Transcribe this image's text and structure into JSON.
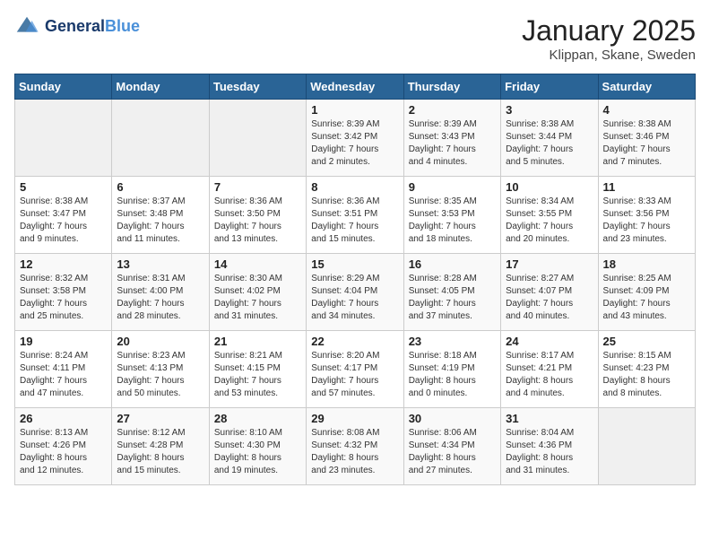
{
  "header": {
    "logo_line1": "General",
    "logo_line2": "Blue",
    "title": "January 2025",
    "subtitle": "Klippan, Skane, Sweden"
  },
  "weekdays": [
    "Sunday",
    "Monday",
    "Tuesday",
    "Wednesday",
    "Thursday",
    "Friday",
    "Saturday"
  ],
  "weeks": [
    [
      {
        "day": "",
        "info": ""
      },
      {
        "day": "",
        "info": ""
      },
      {
        "day": "",
        "info": ""
      },
      {
        "day": "1",
        "info": "Sunrise: 8:39 AM\nSunset: 3:42 PM\nDaylight: 7 hours\nand 2 minutes."
      },
      {
        "day": "2",
        "info": "Sunrise: 8:39 AM\nSunset: 3:43 PM\nDaylight: 7 hours\nand 4 minutes."
      },
      {
        "day": "3",
        "info": "Sunrise: 8:38 AM\nSunset: 3:44 PM\nDaylight: 7 hours\nand 5 minutes."
      },
      {
        "day": "4",
        "info": "Sunrise: 8:38 AM\nSunset: 3:46 PM\nDaylight: 7 hours\nand 7 minutes."
      }
    ],
    [
      {
        "day": "5",
        "info": "Sunrise: 8:38 AM\nSunset: 3:47 PM\nDaylight: 7 hours\nand 9 minutes."
      },
      {
        "day": "6",
        "info": "Sunrise: 8:37 AM\nSunset: 3:48 PM\nDaylight: 7 hours\nand 11 minutes."
      },
      {
        "day": "7",
        "info": "Sunrise: 8:36 AM\nSunset: 3:50 PM\nDaylight: 7 hours\nand 13 minutes."
      },
      {
        "day": "8",
        "info": "Sunrise: 8:36 AM\nSunset: 3:51 PM\nDaylight: 7 hours\nand 15 minutes."
      },
      {
        "day": "9",
        "info": "Sunrise: 8:35 AM\nSunset: 3:53 PM\nDaylight: 7 hours\nand 18 minutes."
      },
      {
        "day": "10",
        "info": "Sunrise: 8:34 AM\nSunset: 3:55 PM\nDaylight: 7 hours\nand 20 minutes."
      },
      {
        "day": "11",
        "info": "Sunrise: 8:33 AM\nSunset: 3:56 PM\nDaylight: 7 hours\nand 23 minutes."
      }
    ],
    [
      {
        "day": "12",
        "info": "Sunrise: 8:32 AM\nSunset: 3:58 PM\nDaylight: 7 hours\nand 25 minutes."
      },
      {
        "day": "13",
        "info": "Sunrise: 8:31 AM\nSunset: 4:00 PM\nDaylight: 7 hours\nand 28 minutes."
      },
      {
        "day": "14",
        "info": "Sunrise: 8:30 AM\nSunset: 4:02 PM\nDaylight: 7 hours\nand 31 minutes."
      },
      {
        "day": "15",
        "info": "Sunrise: 8:29 AM\nSunset: 4:04 PM\nDaylight: 7 hours\nand 34 minutes."
      },
      {
        "day": "16",
        "info": "Sunrise: 8:28 AM\nSunset: 4:05 PM\nDaylight: 7 hours\nand 37 minutes."
      },
      {
        "day": "17",
        "info": "Sunrise: 8:27 AM\nSunset: 4:07 PM\nDaylight: 7 hours\nand 40 minutes."
      },
      {
        "day": "18",
        "info": "Sunrise: 8:25 AM\nSunset: 4:09 PM\nDaylight: 7 hours\nand 43 minutes."
      }
    ],
    [
      {
        "day": "19",
        "info": "Sunrise: 8:24 AM\nSunset: 4:11 PM\nDaylight: 7 hours\nand 47 minutes."
      },
      {
        "day": "20",
        "info": "Sunrise: 8:23 AM\nSunset: 4:13 PM\nDaylight: 7 hours\nand 50 minutes."
      },
      {
        "day": "21",
        "info": "Sunrise: 8:21 AM\nSunset: 4:15 PM\nDaylight: 7 hours\nand 53 minutes."
      },
      {
        "day": "22",
        "info": "Sunrise: 8:20 AM\nSunset: 4:17 PM\nDaylight: 7 hours\nand 57 minutes."
      },
      {
        "day": "23",
        "info": "Sunrise: 8:18 AM\nSunset: 4:19 PM\nDaylight: 8 hours\nand 0 minutes."
      },
      {
        "day": "24",
        "info": "Sunrise: 8:17 AM\nSunset: 4:21 PM\nDaylight: 8 hours\nand 4 minutes."
      },
      {
        "day": "25",
        "info": "Sunrise: 8:15 AM\nSunset: 4:23 PM\nDaylight: 8 hours\nand 8 minutes."
      }
    ],
    [
      {
        "day": "26",
        "info": "Sunrise: 8:13 AM\nSunset: 4:26 PM\nDaylight: 8 hours\nand 12 minutes."
      },
      {
        "day": "27",
        "info": "Sunrise: 8:12 AM\nSunset: 4:28 PM\nDaylight: 8 hours\nand 15 minutes."
      },
      {
        "day": "28",
        "info": "Sunrise: 8:10 AM\nSunset: 4:30 PM\nDaylight: 8 hours\nand 19 minutes."
      },
      {
        "day": "29",
        "info": "Sunrise: 8:08 AM\nSunset: 4:32 PM\nDaylight: 8 hours\nand 23 minutes."
      },
      {
        "day": "30",
        "info": "Sunrise: 8:06 AM\nSunset: 4:34 PM\nDaylight: 8 hours\nand 27 minutes."
      },
      {
        "day": "31",
        "info": "Sunrise: 8:04 AM\nSunset: 4:36 PM\nDaylight: 8 hours\nand 31 minutes."
      },
      {
        "day": "",
        "info": ""
      }
    ]
  ]
}
